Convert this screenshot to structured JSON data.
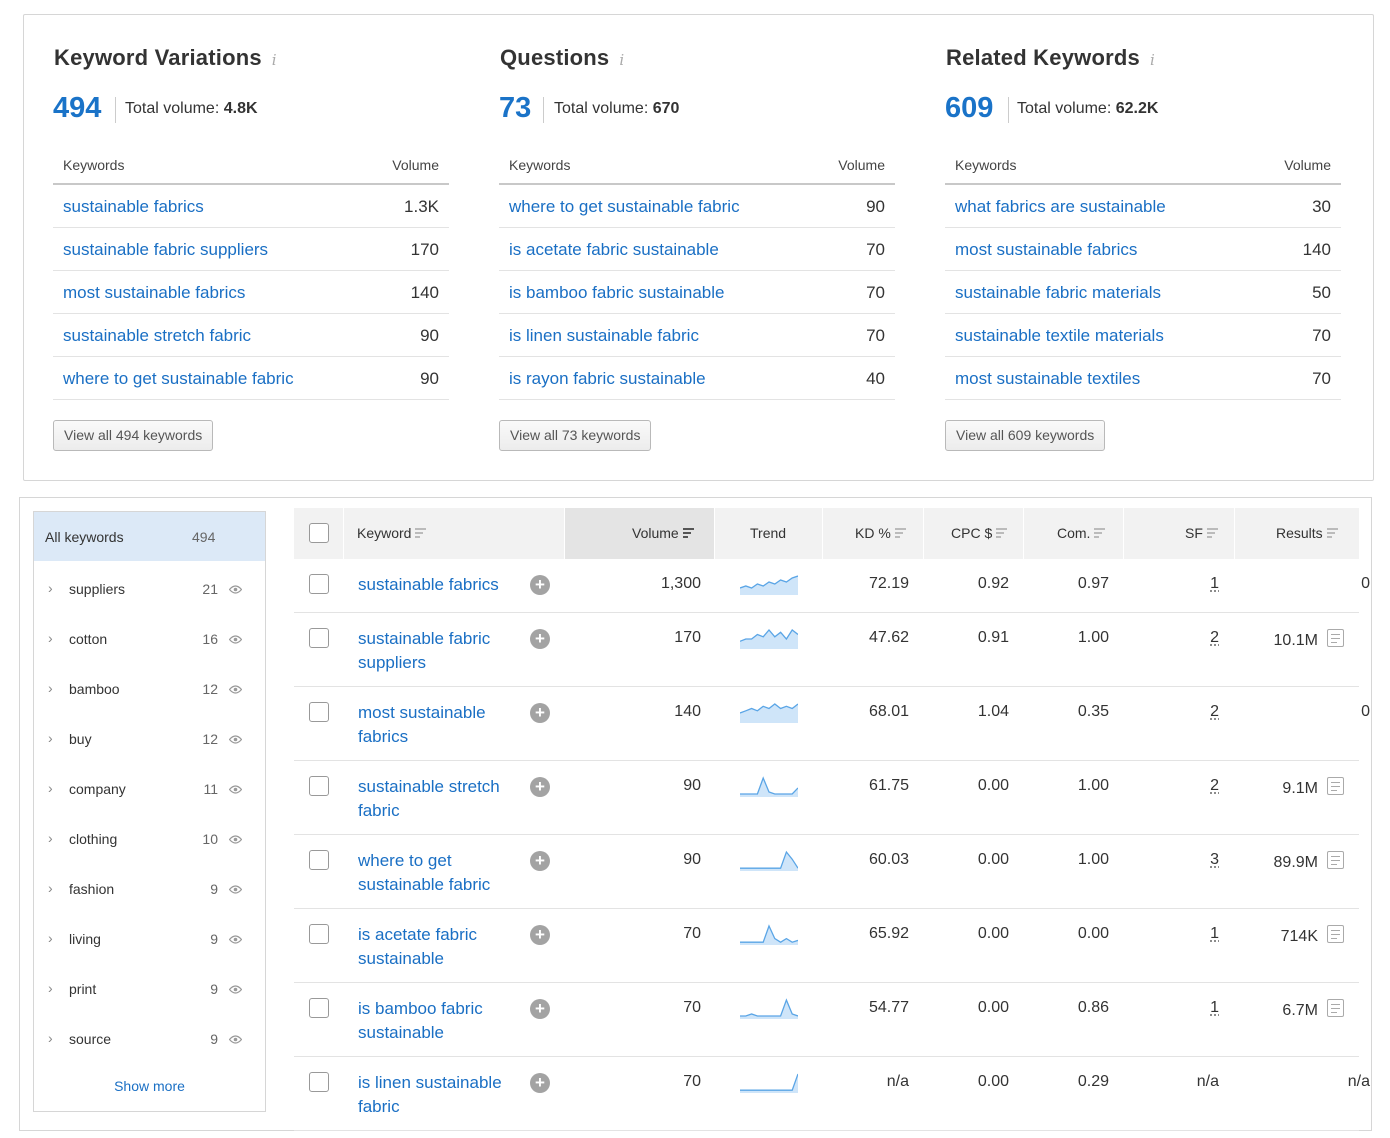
{
  "overview": [
    {
      "title": "Keyword Variations",
      "count": "494",
      "total_label": "Total volume:",
      "total_value": "4.8K",
      "col_keywords": "Keywords",
      "col_volume": "Volume",
      "rows": [
        {
          "k": "sustainable fabrics",
          "v": "1.3K"
        },
        {
          "k": "sustainable fabric suppliers",
          "v": "170"
        },
        {
          "k": "most sustainable fabrics",
          "v": "140"
        },
        {
          "k": "sustainable stretch fabric",
          "v": "90"
        },
        {
          "k": "where to get sustainable fabric",
          "v": "90"
        }
      ],
      "button": "View all 494 keywords"
    },
    {
      "title": "Questions",
      "count": "73",
      "total_label": "Total volume:",
      "total_value": "670",
      "col_keywords": "Keywords",
      "col_volume": "Volume",
      "rows": [
        {
          "k": "where to get sustainable fabric",
          "v": "90"
        },
        {
          "k": "is acetate fabric sustainable",
          "v": "70"
        },
        {
          "k": "is bamboo fabric sustainable",
          "v": "70"
        },
        {
          "k": "is linen sustainable fabric",
          "v": "70"
        },
        {
          "k": "is rayon fabric sustainable",
          "v": "40"
        }
      ],
      "button": "View all 73 keywords"
    },
    {
      "title": "Related Keywords",
      "count": "609",
      "total_label": "Total volume:",
      "total_value": "62.2K",
      "col_keywords": "Keywords",
      "col_volume": "Volume",
      "rows": [
        {
          "k": "what fabrics are sustainable",
          "v": "30"
        },
        {
          "k": "most sustainable fabrics",
          "v": "140"
        },
        {
          "k": "sustainable fabric materials",
          "v": "50"
        },
        {
          "k": "sustainable textile materials",
          "v": "70"
        },
        {
          "k": "most sustainable textiles",
          "v": "70"
        }
      ],
      "button": "View all 609 keywords"
    }
  ],
  "groups": {
    "all_label": "All keywords",
    "all_count": "494",
    "items": [
      {
        "label": "suppliers",
        "count": "21"
      },
      {
        "label": "cotton",
        "count": "16"
      },
      {
        "label": "bamboo",
        "count": "12"
      },
      {
        "label": "buy",
        "count": "12"
      },
      {
        "label": "company",
        "count": "11"
      },
      {
        "label": "clothing",
        "count": "10"
      },
      {
        "label": "fashion",
        "count": "9"
      },
      {
        "label": "living",
        "count": "9"
      },
      {
        "label": "print",
        "count": "9"
      },
      {
        "label": "source",
        "count": "9"
      }
    ],
    "show_more": "Show more"
  },
  "table": {
    "headers": {
      "keyword": "Keyword",
      "volume": "Volume",
      "trend": "Trend",
      "kd": "KD %",
      "cpc": "CPC $",
      "com": "Com.",
      "sf": "SF",
      "results": "Results"
    },
    "rows": [
      {
        "keyword": "sustainable fabrics",
        "volume": "1,300",
        "trend": [
          3,
          4,
          3,
          5,
          4,
          6,
          5,
          7,
          6,
          8,
          9
        ],
        "kd": "72.19",
        "cpc": "0.92",
        "com": "0.97",
        "sf": "1",
        "results": "0",
        "serp": false
      },
      {
        "keyword": "sustainable fabric suppliers",
        "volume": "170",
        "trend": [
          3,
          4,
          4,
          6,
          5,
          8,
          5,
          7,
          4,
          8,
          6
        ],
        "kd": "47.62",
        "cpc": "0.91",
        "com": "1.00",
        "sf": "2",
        "results": "10.1M",
        "serp": true
      },
      {
        "keyword": "most sustainable fabrics",
        "volume": "140",
        "trend": [
          4,
          5,
          6,
          5,
          7,
          6,
          8,
          6,
          7,
          6,
          8
        ],
        "kd": "68.01",
        "cpc": "1.04",
        "com": "0.35",
        "sf": "2",
        "results": "0",
        "serp": false
      },
      {
        "keyword": "sustainable stretch fabric",
        "volume": "90",
        "trend": [
          1,
          1,
          1,
          1,
          9,
          2,
          1,
          1,
          1,
          1,
          4
        ],
        "kd": "61.75",
        "cpc": "0.00",
        "com": "1.00",
        "sf": "2",
        "results": "9.1M",
        "serp": true
      },
      {
        "keyword": "where to get sustainable fabric",
        "volume": "90",
        "trend": [
          1,
          1,
          1,
          1,
          1,
          1,
          1,
          1,
          10,
          6,
          1
        ],
        "kd": "60.03",
        "cpc": "0.00",
        "com": "1.00",
        "sf": "3",
        "results": "89.9M",
        "serp": true
      },
      {
        "keyword": "is acetate fabric sustainable",
        "volume": "70",
        "trend": [
          1,
          1,
          1,
          1,
          1,
          10,
          3,
          1,
          3,
          1,
          2
        ],
        "kd": "65.92",
        "cpc": "0.00",
        "com": "0.00",
        "sf": "1",
        "results": "714K",
        "serp": true
      },
      {
        "keyword": "is bamboo fabric sustainable",
        "volume": "70",
        "trend": [
          1,
          1,
          2,
          1,
          1,
          1,
          1,
          1,
          9,
          2,
          1
        ],
        "kd": "54.77",
        "cpc": "0.00",
        "com": "0.86",
        "sf": "1",
        "results": "6.7M",
        "serp": true
      },
      {
        "keyword": "is linen sustainable fabric",
        "volume": "70",
        "trend": [
          1,
          1,
          1,
          1,
          1,
          1,
          1,
          1,
          1,
          1,
          10
        ],
        "kd": "n/a",
        "cpc": "0.00",
        "com": "0.29",
        "sf": "n/a",
        "results": "n/a",
        "serp": false
      }
    ]
  },
  "colors": {
    "link": "#1a6fc4",
    "accent": "#1a73c8",
    "selected_group": "#dce9f7",
    "trend_line": "#5aa5e6",
    "trend_fill": "#cfe5f9"
  }
}
